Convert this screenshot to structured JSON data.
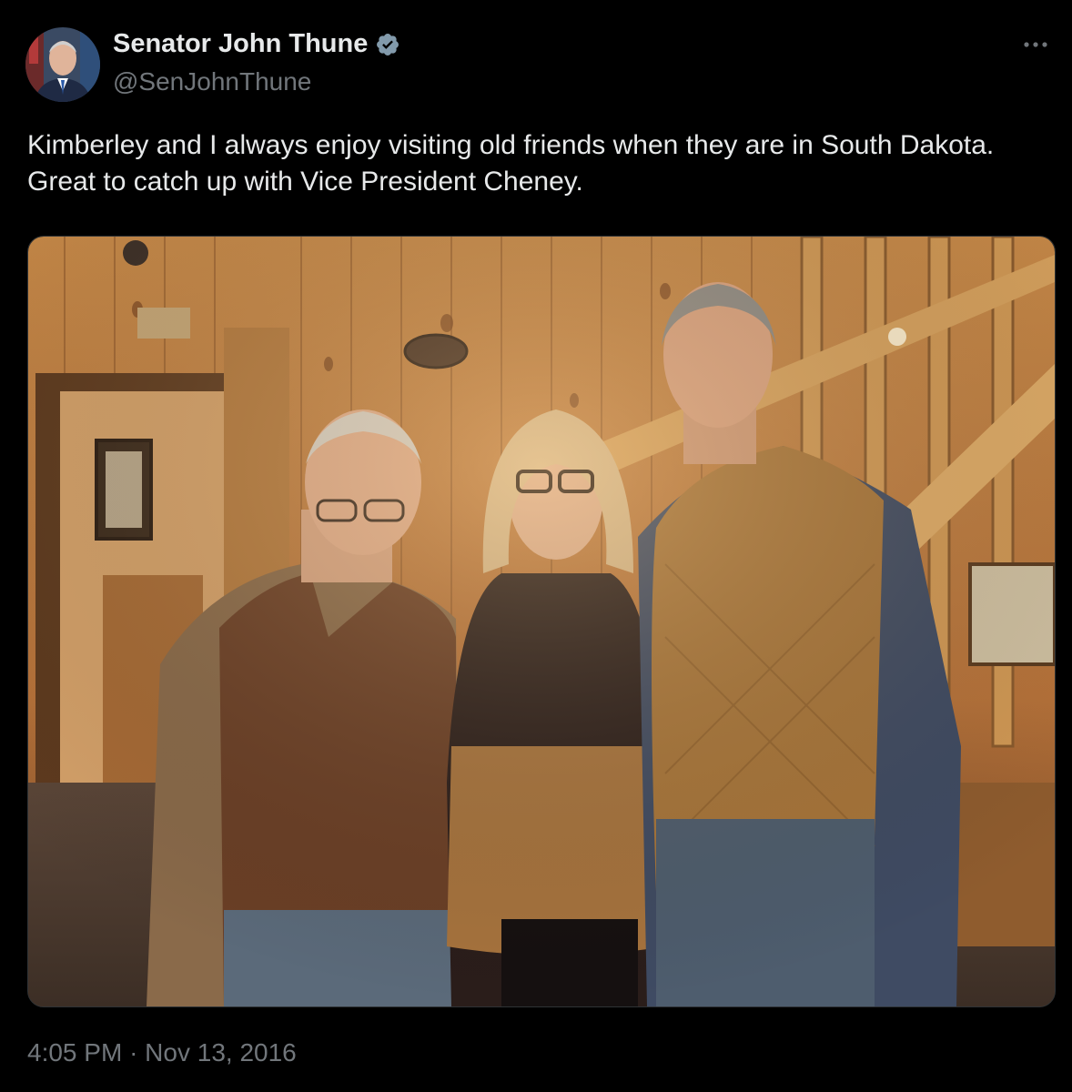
{
  "author": {
    "display_name": "Senator John Thune",
    "handle": "@SenJohnThune",
    "verified_icon": "verified-badge-icon",
    "avatar": "avatar"
  },
  "tweet": {
    "text": "Kimberley and I always enjoy visiting old friends when they are in South Dakota. Great to catch up with Vice President Cheney.",
    "time": "4:05 PM",
    "separator": "·",
    "date": "Nov 13, 2016"
  },
  "menu": {
    "icon": "more-options-icon"
  },
  "colors": {
    "background": "#000000",
    "text_primary": "#e7e9ea",
    "text_secondary": "#71767b",
    "verified_badge": "#829aab"
  }
}
